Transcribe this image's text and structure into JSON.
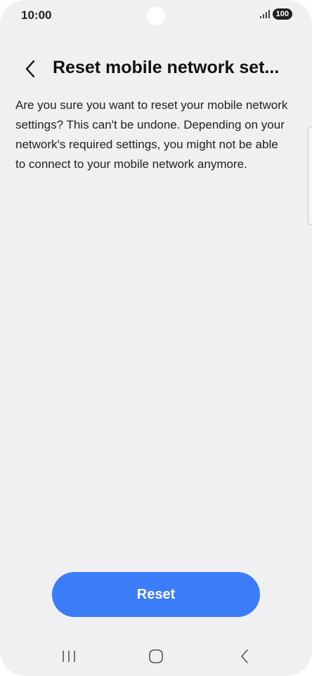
{
  "status_bar": {
    "time": "10:00",
    "battery": "100"
  },
  "header": {
    "title": "Reset mobile network set..."
  },
  "main": {
    "message": "Are you sure you want to reset your mobile network settings? This can't be undone. Depending on your network's required settings, you might not be able to connect to your mobile network anymore."
  },
  "actions": {
    "reset_label": "Reset"
  },
  "icons": {
    "back": "chevron-left-icon",
    "signal": "signal-icon",
    "nav_recents": "recents-icon",
    "nav_home": "home-icon",
    "nav_back": "back-icon"
  },
  "colors": {
    "accent": "#3b7cf8",
    "background": "#f0f0f3"
  }
}
